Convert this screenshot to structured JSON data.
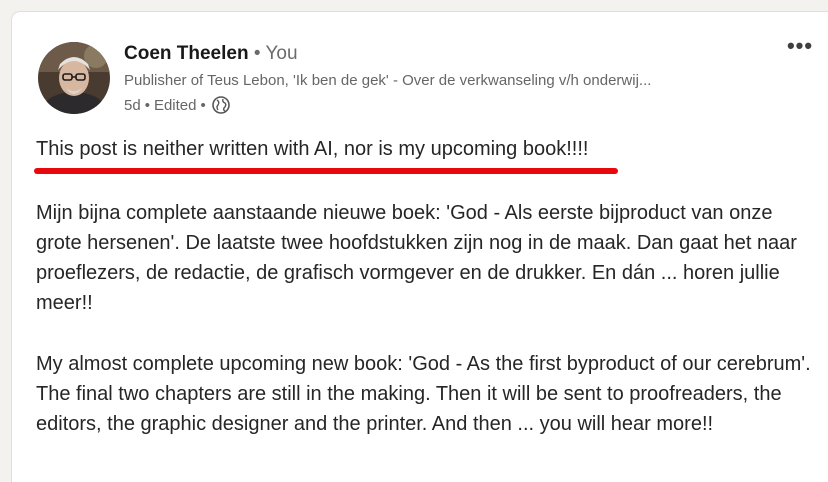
{
  "post": {
    "author": {
      "name": "Coen Theelen",
      "separator": "•",
      "relation": "You",
      "headline": "Publisher of Teus Lebon, 'Ik ben de gek' - Over de verkwanseling v/h onderwij...",
      "time": "5d",
      "edited": "Edited",
      "visibility_icon": "globe-icon"
    },
    "menu_icon": "•••",
    "highlight_line": "This post is neither written with AI, nor is my upcoming book!!!!",
    "paragraphs": [
      "Mijn bijna complete aanstaande nieuwe boek: 'God - Als eerste bijproduct van onze grote hersenen'. De laatste twee hoofdstukken zijn nog in de maak. Dan gaat het naar proeflezers, de redactie, de grafisch vormgever en de drukker. En dán ... horen jullie meer!!",
      "My almost complete upcoming new book: 'God - As the first byproduct of our cerebrum'. The final two chapters are still in the making. Then it will be sent to proofreaders, the editors, the graphic designer and the printer. And then ... you will hear more!!"
    ],
    "colors": {
      "underline": "#e8090f",
      "text": "#262626",
      "muted": "#666666"
    }
  }
}
